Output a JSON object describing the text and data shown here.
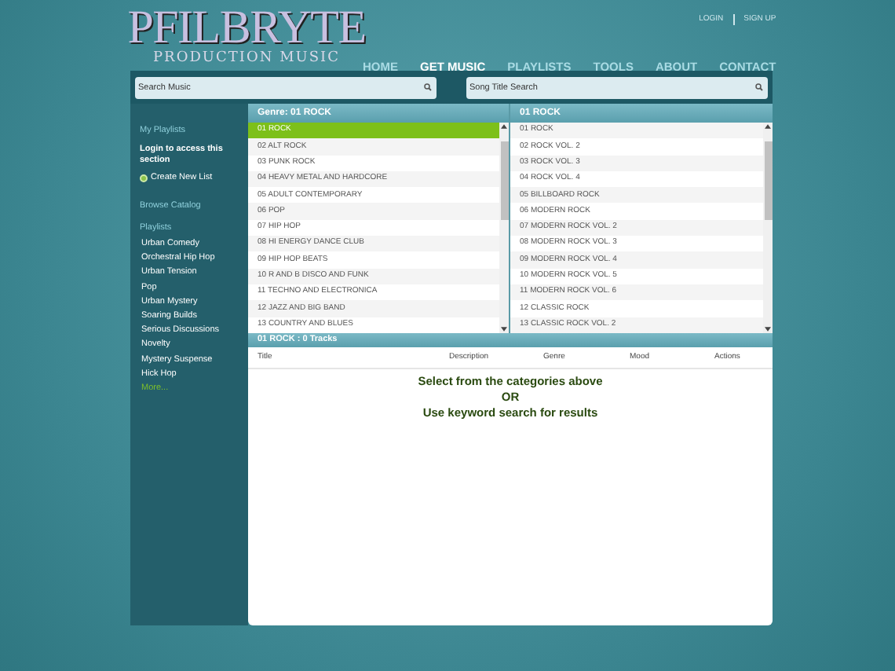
{
  "header": {
    "logo": {
      "title": "PFILBRYTE",
      "subtitle": "PRODUCTION MUSIC"
    },
    "account_links": [
      "LOGIN",
      "SIGN UP"
    ],
    "nav": [
      {
        "label": "HOME",
        "selected": false
      },
      {
        "label": "GET MUSIC",
        "selected": true
      },
      {
        "label": "PLAYLISTS",
        "selected": false
      },
      {
        "label": "TOOLS",
        "selected": false
      },
      {
        "label": "ABOUT",
        "selected": false
      },
      {
        "label": "CONTACT",
        "selected": false
      }
    ]
  },
  "search": [
    {
      "placeholder": "Search Music"
    },
    {
      "placeholder": "Song Title Search"
    }
  ],
  "sidebar": {
    "my_playlists_heading": "My Playlists",
    "login_note": "Login to access this section",
    "create_link": "Create New List",
    "browse_link": "Browse Catalog",
    "playlists_heading": "Playlists",
    "playlists": [
      "Urban Comedy",
      "Orchestral Hip Hop",
      "Urban Tension",
      "Pop",
      "Urban Mystery",
      "Soaring Builds",
      "Serious Discussions",
      "Novelty",
      "Mystery Suspense",
      "Hick Hop"
    ],
    "more_link": "More..."
  },
  "genre_panel": {
    "title": "Genre: 01 ROCK",
    "items": [
      {
        "label": "01 ROCK",
        "selected": true
      },
      {
        "label": "02 ALT ROCK",
        "selected": false
      },
      {
        "label": "03 PUNK ROCK",
        "selected": false
      },
      {
        "label": "04 HEAVY METAL AND HARDCORE",
        "selected": false
      },
      {
        "label": "05 ADULT CONTEMPORARY",
        "selected": false
      },
      {
        "label": "06 POP",
        "selected": false
      },
      {
        "label": "07 HIP HOP",
        "selected": false
      },
      {
        "label": "08 HI ENERGY DANCE CLUB",
        "selected": false
      },
      {
        "label": "09 HIP HOP BEATS",
        "selected": false
      },
      {
        "label": "10 R AND B DISCO AND FUNK",
        "selected": false
      },
      {
        "label": "11 TECHNO AND ELECTRONICA",
        "selected": false
      },
      {
        "label": "12 JAZZ AND BIG BAND",
        "selected": false
      },
      {
        "label": "13 COUNTRY AND BLUES",
        "selected": false
      }
    ]
  },
  "album_panel": {
    "title": "01 ROCK",
    "items": [
      "01 ROCK",
      "02 ROCK VOL. 2",
      "03 ROCK VOL. 3",
      "04 ROCK VOL. 4",
      "05 BILLBOARD ROCK",
      "06 MODERN ROCK",
      "07 MODERN ROCK VOL. 2",
      "08 MODERN ROCK VOL. 3",
      "09 MODERN ROCK VOL. 4",
      "10 MODERN ROCK VOL. 5",
      "11 MODERN ROCK VOL. 6",
      "12 CLASSIC ROCK",
      "13 CLASSIC ROCK VOL. 2"
    ]
  },
  "tracks": {
    "title": "01 ROCK : 0 Tracks",
    "columns": [
      "Title",
      "Description",
      "Genre",
      "Mood",
      "Actions"
    ],
    "message_lines": [
      "Select from the categories above",
      "OR",
      "Use keyword search for results"
    ]
  }
}
